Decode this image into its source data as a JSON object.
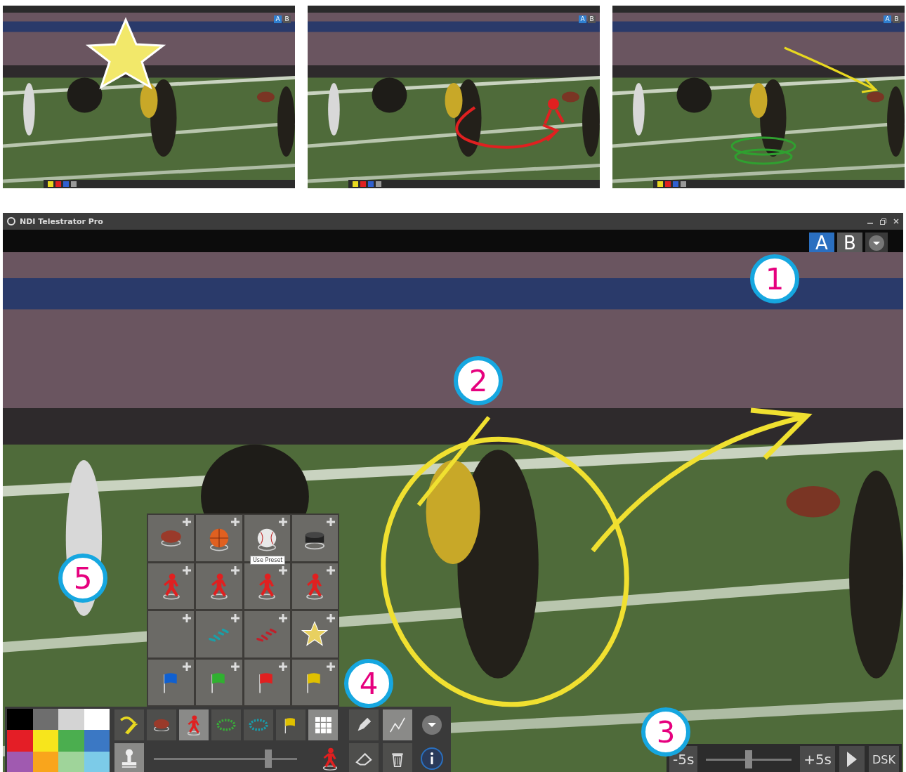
{
  "thumbnails": [
    {
      "kind": "star",
      "buttons": [
        {
          "label": "A",
          "selected": true
        },
        {
          "label": "B",
          "selected": false
        }
      ]
    },
    {
      "kind": "arrow",
      "buttons": [
        {
          "label": "A",
          "selected": true
        },
        {
          "label": "B",
          "selected": false
        }
      ]
    },
    {
      "kind": "path",
      "buttons": [
        {
          "label": "A",
          "selected": true
        },
        {
          "label": "B",
          "selected": false
        }
      ]
    }
  ],
  "window": {
    "title": "NDI Telestrator Pro"
  },
  "output_buttons": [
    {
      "label": "A",
      "selected": true
    },
    {
      "label": "B",
      "selected": false
    }
  ],
  "preset_grid": {
    "tooltip": "Use Preset",
    "items": [
      {
        "kind": "football"
      },
      {
        "kind": "basketball"
      },
      {
        "kind": "baseball"
      },
      {
        "kind": "puck"
      },
      {
        "kind": "player",
        "color": "#e02020"
      },
      {
        "kind": "player",
        "color": "#e02020"
      },
      {
        "kind": "player",
        "color": "#e02020"
      },
      {
        "kind": "player",
        "color": "#e02020"
      },
      {
        "kind": "empty"
      },
      {
        "kind": "trail",
        "color": "#1aa0a8"
      },
      {
        "kind": "trail",
        "color": "#c0202a"
      },
      {
        "kind": "star"
      },
      {
        "kind": "flag",
        "color": "#1060d0"
      },
      {
        "kind": "flag",
        "color": "#30b030"
      },
      {
        "kind": "flag",
        "color": "#e02020"
      },
      {
        "kind": "flag",
        "color": "#e0c000"
      }
    ]
  },
  "palette": [
    {
      "color": "#000000"
    },
    {
      "color": "#6e6e6e"
    },
    {
      "color": "#d4d4d4"
    },
    {
      "color": "#ffffff"
    },
    {
      "color": "#e41e26"
    },
    {
      "color": "#f7e51c"
    },
    {
      "color": "#4bae4f"
    },
    {
      "color": "#3b78c4"
    },
    {
      "color": "#a05ab0"
    },
    {
      "color": "#f9a51c"
    },
    {
      "color": "#9fd49a"
    },
    {
      "color": "#7ccbe8"
    }
  ],
  "tools": [
    {
      "kind": "brush",
      "selected": false
    },
    {
      "kind": "football",
      "selected": false
    },
    {
      "kind": "player",
      "selected": true
    },
    {
      "kind": "ring",
      "color": "#3aa83a",
      "selected": false
    },
    {
      "kind": "ring",
      "color": "#1a9aa8",
      "selected": false
    },
    {
      "kind": "flag",
      "selected": false
    },
    {
      "kind": "grid",
      "selected": true
    }
  ],
  "size_slider": {
    "level": 0.8
  },
  "draw_tools": [
    {
      "kind": "pen",
      "selected": false
    },
    {
      "kind": "line",
      "selected": true
    },
    {
      "kind": "eraser",
      "selected": false
    },
    {
      "kind": "trash",
      "selected": false
    }
  ],
  "timeline": {
    "back": "-5s",
    "forward": "+5s",
    "level": 0.5,
    "dsk": "DSK"
  },
  "callouts": [
    "1",
    "2",
    "3",
    "4",
    "5"
  ]
}
